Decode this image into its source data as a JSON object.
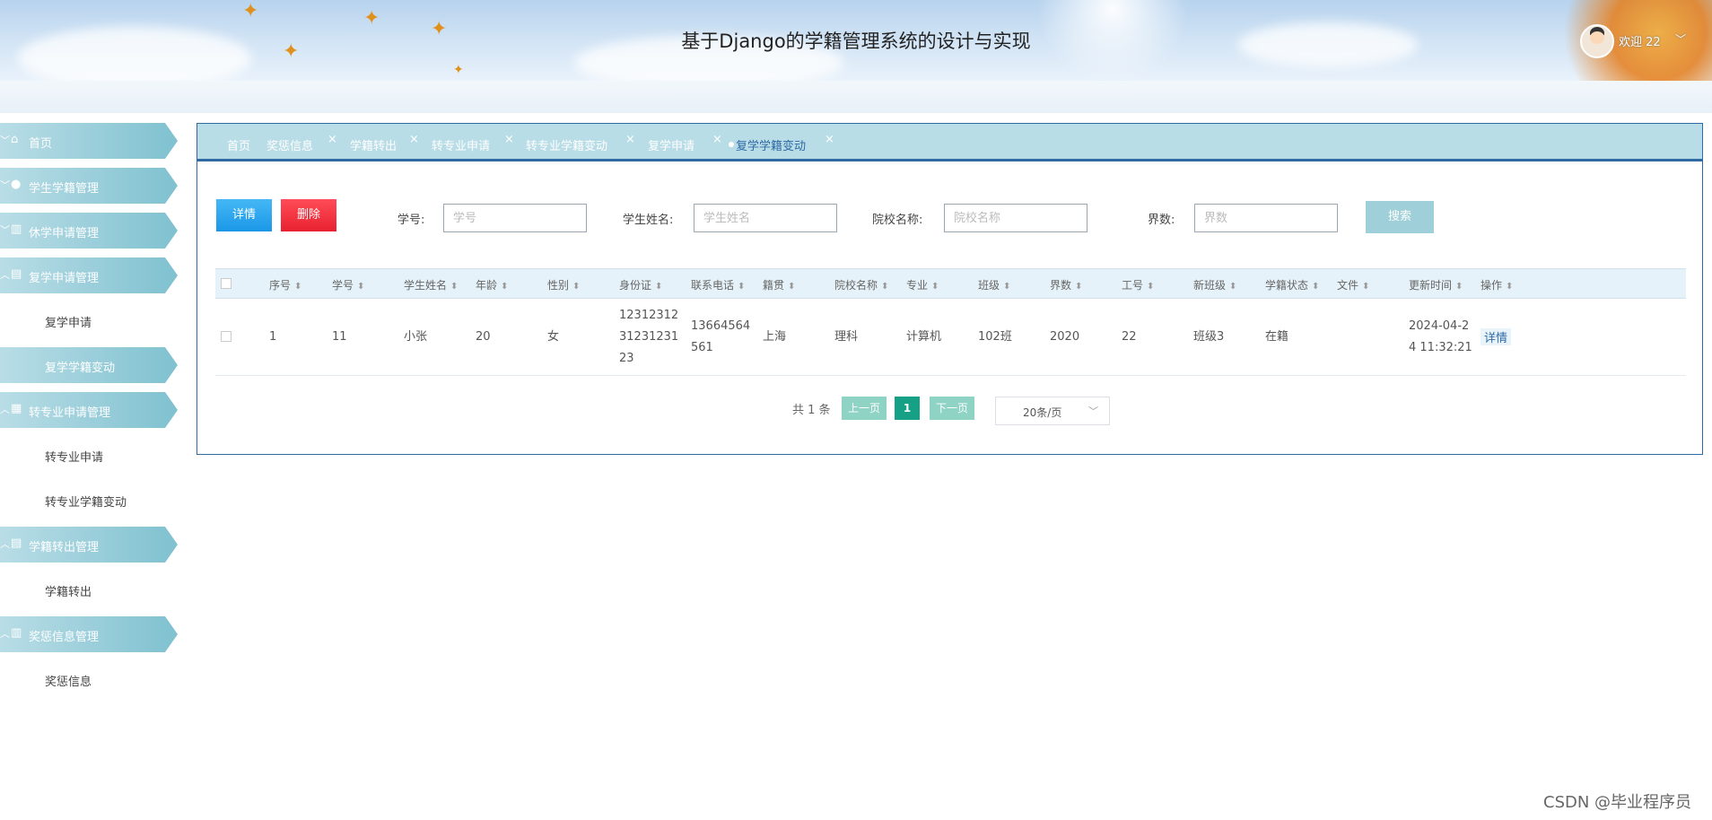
{
  "header": {
    "title": "基于Django的学籍管理系统的设计与实现",
    "welcome": "欢迎 22"
  },
  "sidebar": {
    "items": [
      {
        "type": "head",
        "icon": "home-icon",
        "label": "首页",
        "chevron": "down"
      },
      {
        "type": "head",
        "icon": "drop-icon",
        "label": "学生学籍管理",
        "chevron": "down"
      },
      {
        "type": "head",
        "icon": "chart-icon",
        "label": "休学申请管理",
        "chevron": "down"
      },
      {
        "type": "head",
        "icon": "image-icon",
        "label": "复学申请管理",
        "chevron": "up"
      },
      {
        "type": "sub",
        "label": "复学申请",
        "active": false
      },
      {
        "type": "sub",
        "label": "复学学籍变动",
        "active": true
      },
      {
        "type": "head",
        "icon": "building-icon",
        "label": "转专业申请管理",
        "chevron": "up"
      },
      {
        "type": "sub",
        "label": "转专业申请",
        "active": false
      },
      {
        "type": "sub",
        "label": "转专业学籍变动",
        "active": false
      },
      {
        "type": "head",
        "icon": "table-icon",
        "label": "学籍转出管理",
        "chevron": "up"
      },
      {
        "type": "sub",
        "label": "学籍转出",
        "active": false
      },
      {
        "type": "head",
        "icon": "book-icon",
        "label": "奖惩信息管理",
        "chevron": "up"
      },
      {
        "type": "sub",
        "label": "奖惩信息",
        "active": false
      }
    ]
  },
  "tabs": [
    {
      "label": "首页",
      "closable": false,
      "active": false
    },
    {
      "label": "奖惩信息",
      "closable": true,
      "active": false
    },
    {
      "label": "学籍转出",
      "closable": true,
      "active": false
    },
    {
      "label": "转专业申请",
      "closable": true,
      "active": false
    },
    {
      "label": "转专业学籍变动",
      "closable": true,
      "active": false
    },
    {
      "label": "复学申请",
      "closable": true,
      "active": false
    },
    {
      "label": "复学学籍变动",
      "closable": true,
      "active": true
    }
  ],
  "toolbar": {
    "detail_label": "详情",
    "delete_label": "删除",
    "search_label": "搜索"
  },
  "filters": {
    "student_no_label": "学号:",
    "student_no_placeholder": "学号",
    "student_name_label": "学生姓名:",
    "student_name_placeholder": "学生姓名",
    "school_label": "院校名称:",
    "school_placeholder": "院校名称",
    "grade_label": "界数:",
    "grade_placeholder": "界数"
  },
  "table": {
    "columns": [
      "序号",
      "学号",
      "学生姓名",
      "年龄",
      "性别",
      "身份证",
      "联系电话",
      "籍贯",
      "院校名称",
      "专业",
      "班级",
      "界数",
      "工号",
      "新班级",
      "学籍状态",
      "文件",
      "更新时间",
      "操作"
    ],
    "rows": [
      {
        "index": "1",
        "student_no": "11",
        "name": "小张",
        "age": "20",
        "gender": "女",
        "id_card_lines": [
          "12312312",
          "31231231",
          "23"
        ],
        "phone_lines": [
          "13664564",
          "561"
        ],
        "hometown": "上海",
        "school": "理科",
        "major": "计算机",
        "class": "102班",
        "grade": "2020",
        "staff_no": "22",
        "new_class": "班级3",
        "status": "在籍",
        "file": "",
        "updated_lines": [
          "2024-04-2",
          "4 11:32:21"
        ],
        "action": "详情"
      }
    ]
  },
  "pagination": {
    "total": "共 1 条",
    "prev": "上一页",
    "current": "1",
    "next": "下一页",
    "page_size": "20条/页"
  },
  "watermark": "CSDN @毕业程序员"
}
